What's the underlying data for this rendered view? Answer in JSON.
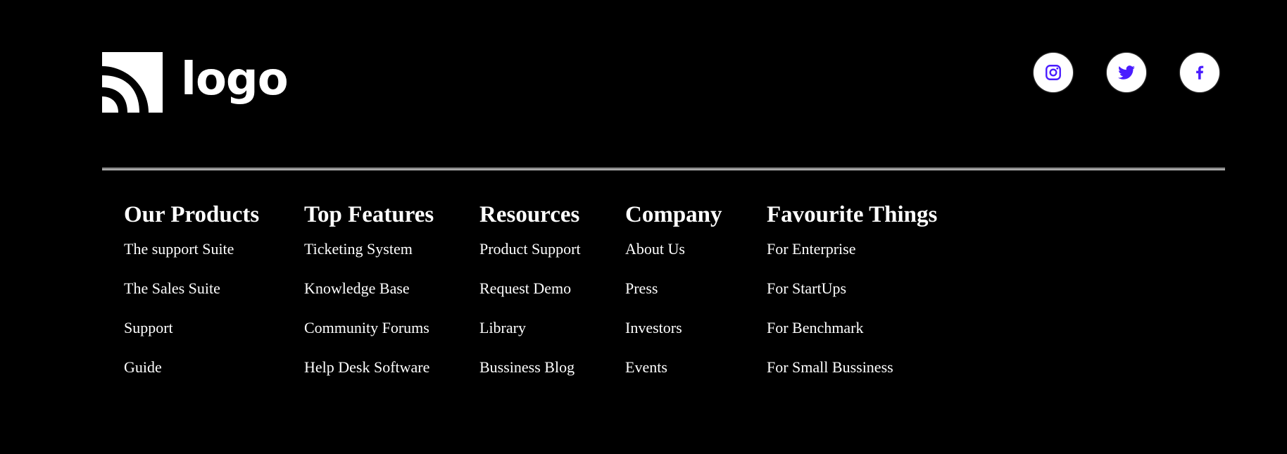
{
  "logo": {
    "text": "logo",
    "icon": "rss-waves-icon"
  },
  "social": [
    {
      "name": "instagram",
      "icon": "instagram-icon"
    },
    {
      "name": "twitter",
      "icon": "twitter-icon"
    },
    {
      "name": "facebook",
      "icon": "facebook-icon"
    }
  ],
  "colors": {
    "background": "#000000",
    "text": "#ffffff",
    "social_icon": "#4a1cff",
    "divider": "#8a8a8a"
  },
  "columns": [
    {
      "heading": "Our Products",
      "links": [
        "The support Suite",
        "The Sales Suite",
        "Support",
        "Guide"
      ]
    },
    {
      "heading": "Top Features",
      "links": [
        "Ticketing System",
        "Knowledge Base",
        "Community Forums",
        "Help Desk Software"
      ]
    },
    {
      "heading": "Resources",
      "links": [
        "Product Support",
        "Request Demo",
        "Library",
        "Bussiness Blog"
      ]
    },
    {
      "heading": "Company",
      "links": [
        "About Us",
        "Press",
        "Investors",
        "Events"
      ]
    },
    {
      "heading": "Favourite Things",
      "links": [
        "For Enterprise",
        "For StartUps",
        "For Benchmark",
        "For Small Bussiness"
      ]
    }
  ]
}
